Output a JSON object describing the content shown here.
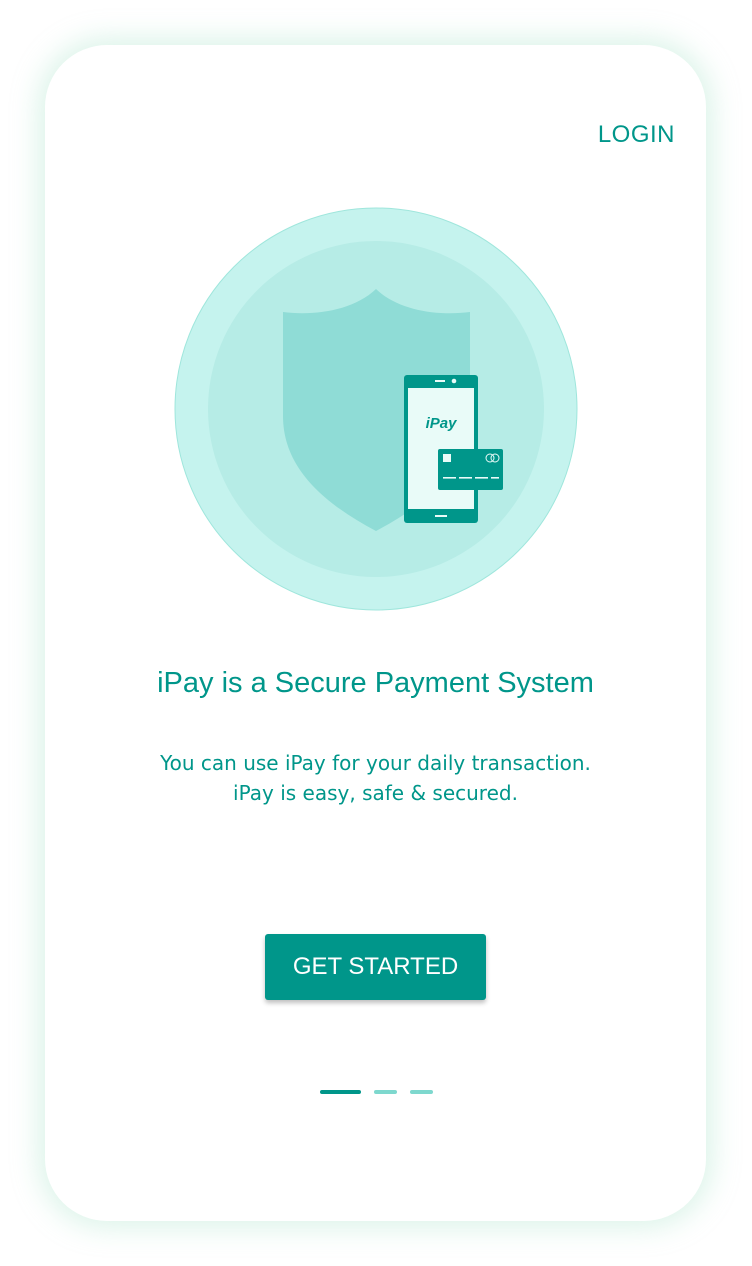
{
  "header": {
    "login_label": "LOGIN"
  },
  "illustration": {
    "brand_text": "iPay",
    "icons": [
      "shield-icon",
      "smartphone-icon",
      "credit-card-icon"
    ]
  },
  "content": {
    "title": "iPay is a Secure Payment System",
    "description": "You can use iPay for your daily transaction. iPay is easy, safe & secured."
  },
  "actions": {
    "get_started_label": "GET STARTED"
  },
  "pager": {
    "total": 3,
    "active_index": 0
  },
  "colors": {
    "accent": "#00968a",
    "circle_outer": "#c5f3ee",
    "circle_inner": "#b6ece6",
    "shield": "#8fdcd6",
    "dot_inactive": "#7ed8ce"
  }
}
